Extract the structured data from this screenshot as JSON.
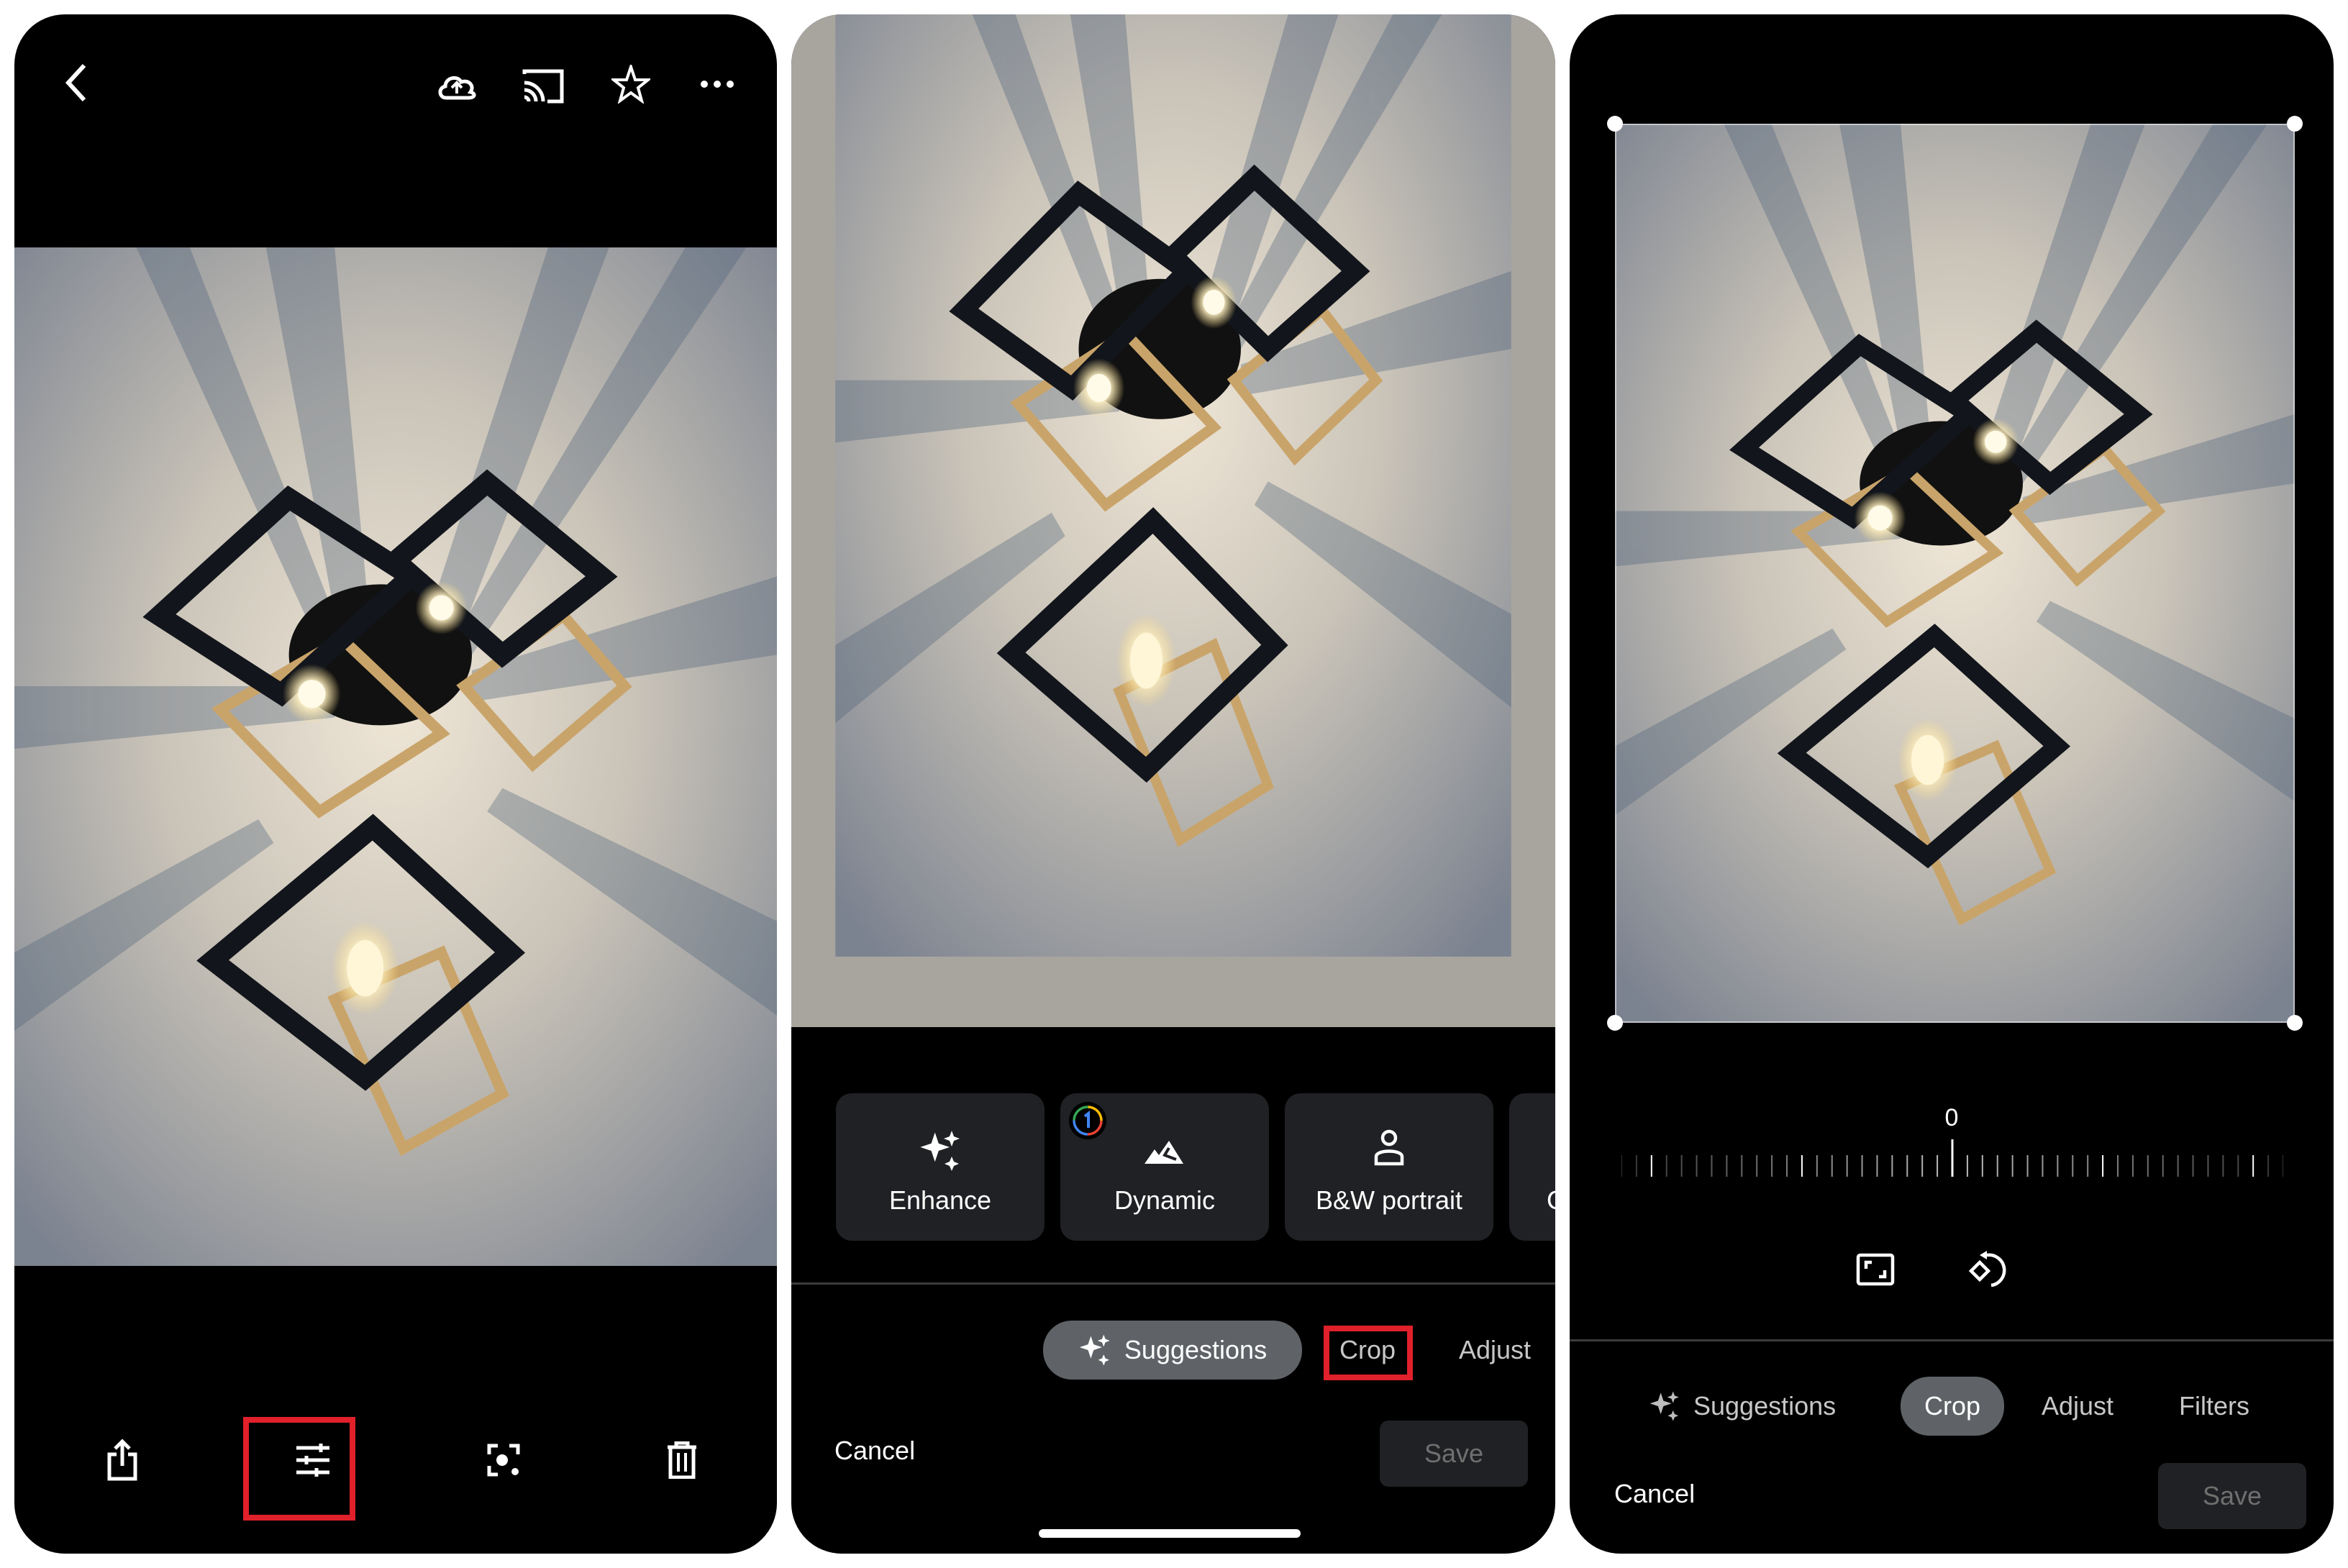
{
  "panel_viewer": {
    "top_bar": {
      "back": "back-icon",
      "actions": [
        "cloud-upload-icon",
        "cast-icon",
        "star-icon",
        "more-horizontal-icon"
      ]
    },
    "bottom_bar": {
      "actions": [
        "share-icon",
        "edit-sliders-icon",
        "lens-icon",
        "trash-icon"
      ],
      "highlighted": "edit-sliders-icon"
    },
    "highlight_color": "#e0202a"
  },
  "panel_editor_suggestions": {
    "suggestion_cards": [
      {
        "label": "Enhance",
        "icon": "sparkle-icon"
      },
      {
        "label": "Dynamic",
        "icon": "mountain-icon",
        "badge": "google-one-icon"
      },
      {
        "label": "B&W portrait",
        "icon": "person-icon"
      },
      {
        "label": "C",
        "icon": "",
        "truncated": true
      }
    ],
    "tabs": [
      {
        "label": "Suggestions",
        "icon": "sparkle-icon",
        "active": true
      },
      {
        "label": "Crop",
        "active": false,
        "highlighted": true
      },
      {
        "label": "Adjust",
        "active": false
      }
    ],
    "cancel_label": "Cancel",
    "save_label": "Save"
  },
  "panel_editor_crop": {
    "rotation_angle": "0",
    "rotation_value": 0,
    "tools": [
      "aspect-ratio-icon",
      "rotate-icon"
    ],
    "tabs": [
      {
        "label": "Suggestions",
        "icon": "sparkle-icon",
        "active": false
      },
      {
        "label": "Crop",
        "active": true
      },
      {
        "label": "Adjust",
        "active": false
      },
      {
        "label": "Filters",
        "active": false
      }
    ],
    "cancel_label": "Cancel",
    "save_label": "Save"
  },
  "colors": {
    "accent_highlight": "#e0202a",
    "active_tab_bg": "#5f6368",
    "card_bg": "#202124",
    "save_disabled_text": "#6f6f6f"
  }
}
